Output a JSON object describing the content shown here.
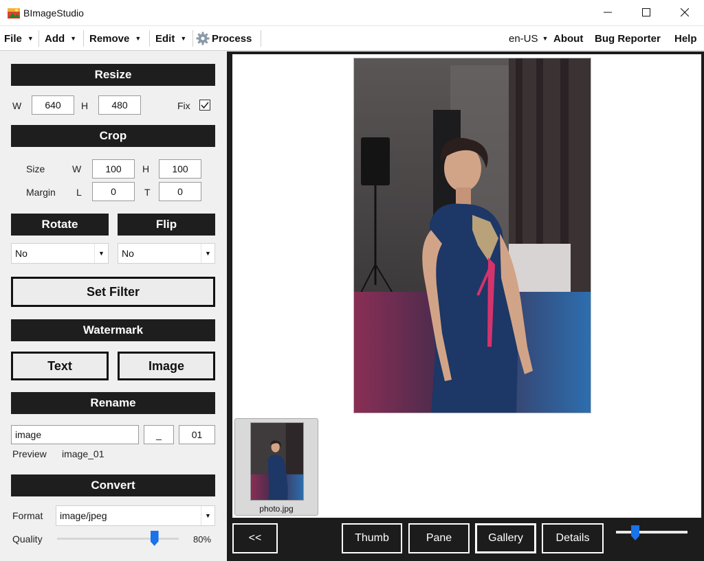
{
  "window": {
    "title": "BImageStudio"
  },
  "menu": {
    "file": "File",
    "add": "Add",
    "remove": "Remove",
    "edit": "Edit",
    "process": "Process",
    "language": "en-US",
    "about": "About",
    "bug_reporter": "Bug Reporter",
    "help": "Help"
  },
  "resize": {
    "header": "Resize",
    "w_label": "W",
    "w_value": "640",
    "h_label": "H",
    "h_value": "480",
    "fix_label": "Fix",
    "fix_checked": true
  },
  "crop": {
    "header": "Crop",
    "size_label": "Size",
    "w_label": "W",
    "w_value": "100",
    "h_label": "H",
    "h_value": "100",
    "margin_label": "Margin",
    "l_label": "L",
    "l_value": "0",
    "t_label": "T",
    "t_value": "0"
  },
  "rotate": {
    "header": "Rotate",
    "value": "No"
  },
  "flip": {
    "header": "Flip",
    "value": "No"
  },
  "filter": {
    "button": "Set Filter"
  },
  "watermark": {
    "header": "Watermark",
    "text_button": "Text",
    "image_button": "Image"
  },
  "rename": {
    "header": "Rename",
    "name_value": "image",
    "separator_value": "_",
    "counter_value": "01",
    "preview_label": "Preview",
    "preview_value": "image_01"
  },
  "convert": {
    "header": "Convert",
    "format_label": "Format",
    "format_value": "image/jpeg",
    "quality_label": "Quality",
    "quality_value": "80%",
    "quality_fraction": 0.8
  },
  "gallery": {
    "thumbnail_name": "photo.jpg",
    "collapse_button": "<<",
    "view_buttons": [
      "Thumb",
      "Pane",
      "Gallery",
      "Details"
    ],
    "active_view": "Gallery"
  },
  "colors": {
    "accent": "#1a73e8",
    "header_bg": "#1e1e1e",
    "panel_bg": "#f0f0f0",
    "viewer_bg": "#1c1c1c"
  }
}
